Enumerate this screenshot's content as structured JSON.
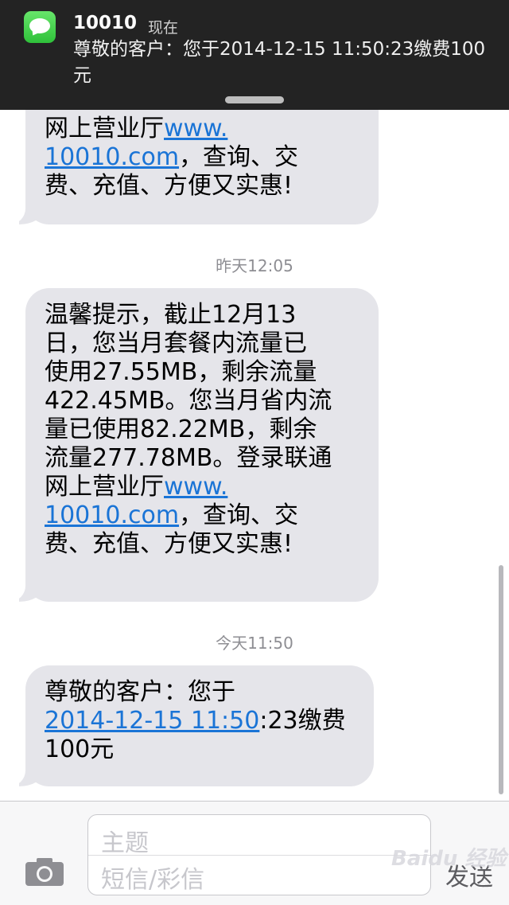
{
  "notification": {
    "sender": "10010",
    "time": "现在",
    "message": "尊敬的客户：您于2014-12-15 11:50:23缴费100元"
  },
  "messages": [
    {
      "lines": "网上营业厅",
      "link1": "www.",
      "link2": "10010.com",
      "tail": "，查询、交\n费、充值、方便又实惠!"
    },
    {
      "timestamp": "昨天12:05",
      "text": "温馨提示，截止12月13\n日，您当月套餐内流量已\n使用27.55MB，剩余流量\n422.45MB。您当月省内流\n量已使用82.22MB，剩余\n流量277.78MB。登录联通\n网上营业厅",
      "link1": "www.",
      "link2": "10010.com",
      "tail": "，查询、交\n费、充值、方便又实惠!"
    },
    {
      "timestamp": "今天11:50",
      "text": "尊敬的客户：您于",
      "link": "2014-12-15 11:50",
      "tail": ":23缴费\n100元"
    }
  ],
  "input": {
    "subject_placeholder": "主题",
    "body_placeholder": "短信/彩信",
    "send_label": "发送"
  },
  "watermark": "Baidu 经验",
  "colors": {
    "bubble": "#e5e5ea",
    "link": "#1a74d6",
    "banner": "#232323"
  }
}
